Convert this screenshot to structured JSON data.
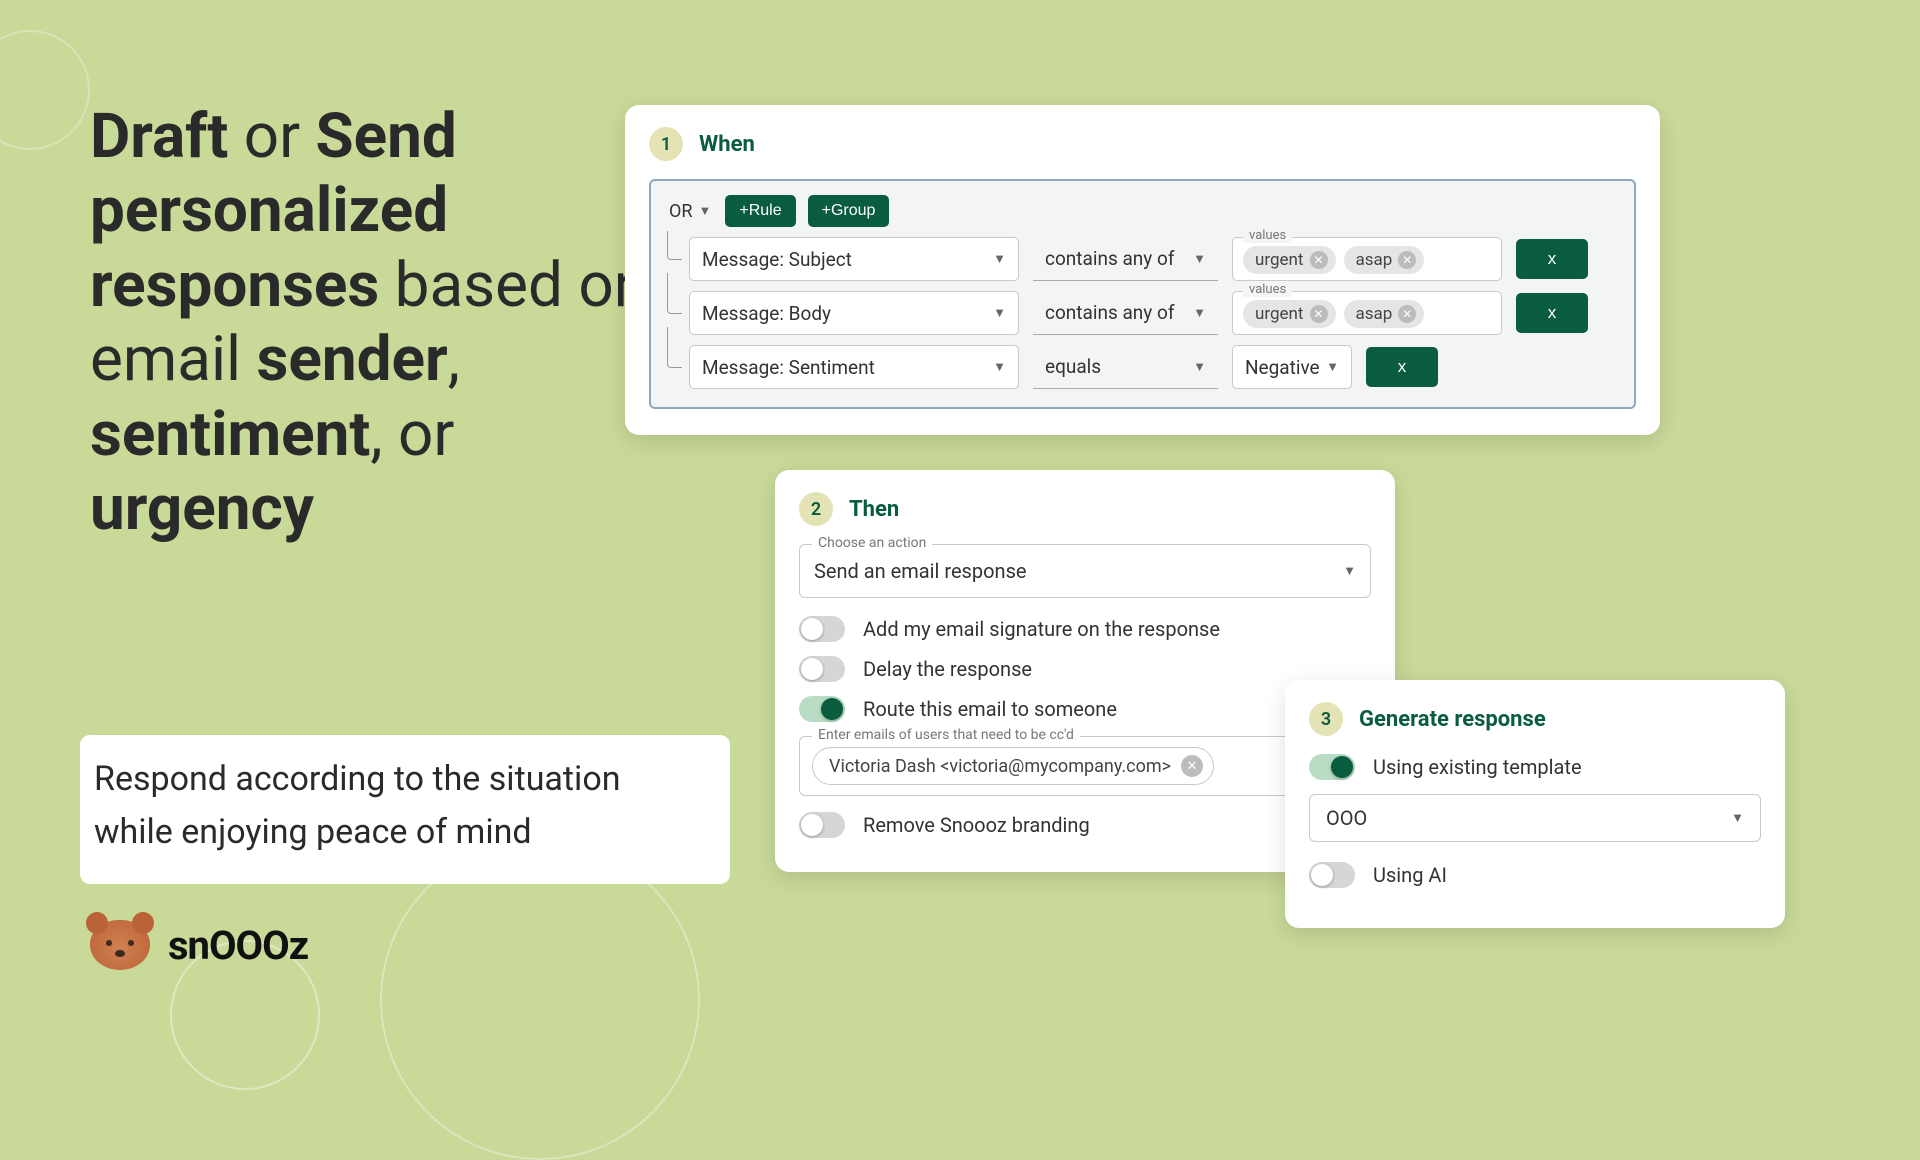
{
  "headline": {
    "part1": "Draft",
    "joiner1": " or ",
    "part2": "Send personalized responses",
    "joiner2": " based on email ",
    "part3": "sender",
    "comma1": ", ",
    "part4": "sentiment",
    "comma2": ", or ",
    "part5": "urgency"
  },
  "subhead": "Respond according to the situation while enjoying peace of mind",
  "brand": "snOOOz",
  "when": {
    "step": "1",
    "title": "When",
    "or_label": "OR",
    "add_rule": "+Rule",
    "add_group": "+Group",
    "values_label": "values",
    "rows": [
      {
        "field": "Message: Subject",
        "op": "contains any of",
        "chips": [
          "urgent",
          "asap"
        ],
        "del": "x"
      },
      {
        "field": "Message: Body",
        "op": "contains any of",
        "chips": [
          "urgent",
          "asap"
        ],
        "del": "x"
      },
      {
        "field": "Message: Sentiment",
        "op": "equals",
        "value": "Negative",
        "del": "x"
      }
    ]
  },
  "then": {
    "step": "2",
    "title": "Then",
    "action_label": "Choose an action",
    "action_value": "Send an email response",
    "toggles": {
      "signature": "Add my email signature on the response",
      "delay": "Delay the response",
      "route": "Route this email to someone",
      "branding": "Remove Snoooz branding"
    },
    "cc_label": "Enter emails of users that need to be cc'd",
    "cc_chip": "Victoria Dash <victoria@mycompany.com>"
  },
  "gen": {
    "step": "3",
    "title": "Generate response",
    "template_toggle": "Using existing template",
    "template_value": "OOO",
    "ai_toggle": "Using AI"
  }
}
